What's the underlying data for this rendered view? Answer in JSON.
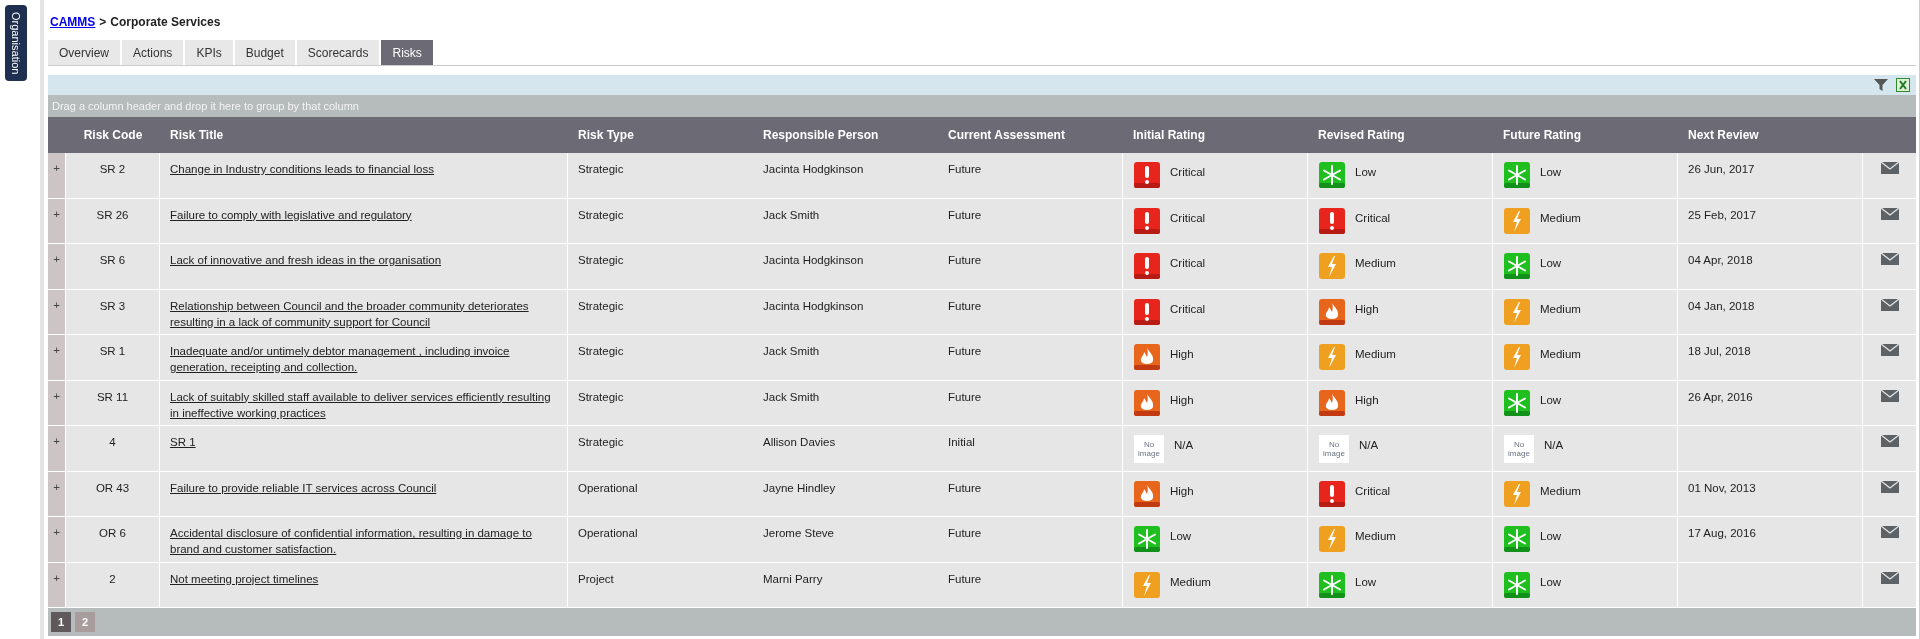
{
  "side_tab": "Organisation",
  "breadcrumb": {
    "link": "CAMMS",
    "separator": ">",
    "current": "Corporate Services"
  },
  "tabs": [
    {
      "label": "Overview",
      "selected": false
    },
    {
      "label": "Actions",
      "selected": false
    },
    {
      "label": "KPIs",
      "selected": false
    },
    {
      "label": "Budget",
      "selected": false
    },
    {
      "label": "Scorecards",
      "selected": false
    },
    {
      "label": "Risks",
      "selected": true
    }
  ],
  "group_hint": "Drag a column header and drop it here to group by that column",
  "table": {
    "columns": [
      "Risk Code",
      "Risk Title",
      "Risk Type",
      "Responsible Person",
      "Current Assessment",
      "Initial Rating",
      "Revised Rating",
      "Future Rating",
      "Next Review"
    ],
    "rows": [
      {
        "expander": "+",
        "code": "SR 2",
        "title": "Change in Industry conditions leads to financial loss",
        "type": "Strategic",
        "person": "Jacinta Hodgkinson",
        "assessment": "Future",
        "ratings": [
          {
            "kind": "critical",
            "label": "Critical"
          },
          {
            "kind": "low",
            "label": "Low"
          },
          {
            "kind": "low",
            "label": "Low"
          }
        ],
        "next_review": "26 Jun, 2017"
      },
      {
        "expander": "+",
        "code": "SR 26",
        "title": "Failure to comply with legislative and regulatory",
        "type": "Strategic",
        "person": "Jack Smith",
        "assessment": "Future",
        "ratings": [
          {
            "kind": "critical",
            "label": "Critical"
          },
          {
            "kind": "critical",
            "label": "Critical"
          },
          {
            "kind": "medium",
            "label": "Medium"
          }
        ],
        "next_review": "25 Feb, 2017"
      },
      {
        "expander": "+",
        "code": "SR 6",
        "title": "Lack of innovative and fresh ideas in the organisation",
        "type": "Strategic",
        "person": "Jacinta Hodgkinson",
        "assessment": "Future",
        "ratings": [
          {
            "kind": "critical",
            "label": "Critical"
          },
          {
            "kind": "medium",
            "label": "Medium"
          },
          {
            "kind": "low",
            "label": "Low"
          }
        ],
        "next_review": "04 Apr, 2018"
      },
      {
        "expander": "+",
        "code": "SR 3",
        "title": "Relationship between Council and the broader community deteriorates resulting in a lack of community support for Council",
        "type": "Strategic",
        "person": "Jacinta Hodgkinson",
        "assessment": "Future",
        "ratings": [
          {
            "kind": "critical",
            "label": "Critical"
          },
          {
            "kind": "high",
            "label": "High"
          },
          {
            "kind": "medium",
            "label": "Medium"
          }
        ],
        "next_review": "04 Jan, 2018"
      },
      {
        "expander": "+",
        "code": "SR 1",
        "title": "Inadequate and/or untimely debtor management , including invoice generation, receipting and collection.",
        "type": "Strategic",
        "person": "Jack Smith",
        "assessment": "Future",
        "ratings": [
          {
            "kind": "high",
            "label": "High"
          },
          {
            "kind": "medium",
            "label": "Medium"
          },
          {
            "kind": "medium",
            "label": "Medium"
          }
        ],
        "next_review": "18 Jul, 2018"
      },
      {
        "expander": "+",
        "code": "SR 11",
        "title": "Lack of suitably skilled staff available to deliver services efficiently resulting in ineffective working practices",
        "type": "Strategic",
        "person": "Jack Smith",
        "assessment": "Future",
        "ratings": [
          {
            "kind": "high",
            "label": "High"
          },
          {
            "kind": "high",
            "label": "High"
          },
          {
            "kind": "low",
            "label": "Low"
          }
        ],
        "next_review": "26 Apr, 2016"
      },
      {
        "expander": "+",
        "code": "4",
        "title": "SR 1",
        "type": "Strategic",
        "person": "Allison Davies",
        "assessment": "Initial",
        "ratings": [
          {
            "kind": "none",
            "label": "N/A",
            "icon_text": "No image"
          },
          {
            "kind": "none",
            "label": "N/A",
            "icon_text": "No image"
          },
          {
            "kind": "none",
            "label": "N/A",
            "icon_text": "No image"
          }
        ]
      },
      {
        "expander": "+",
        "code": "OR 43",
        "title": "Failure to provide reliable IT services across Council",
        "type": "Operational",
        "person": "Jayne Hindley",
        "assessment": "Future",
        "ratings": [
          {
            "kind": "high",
            "label": "High"
          },
          {
            "kind": "critical",
            "label": "Critical"
          },
          {
            "kind": "medium",
            "label": "Medium"
          }
        ],
        "next_review": "01 Nov, 2013"
      },
      {
        "expander": "+",
        "code": "OR 6",
        "title": "Accidental disclosure of confidential information, resulting in damage to brand and customer satisfaction.",
        "type": "Operational",
        "person": "Jerome Steve",
        "assessment": "Future",
        "ratings": [
          {
            "kind": "low",
            "label": "Low"
          },
          {
            "kind": "medium",
            "label": "Medium"
          },
          {
            "kind": "low",
            "label": "Low"
          }
        ],
        "next_review": "17 Aug, 2016"
      },
      {
        "expander": "+",
        "code": "2",
        "title": "Not meeting project timelines",
        "type": "Project",
        "person": "Marni Parry",
        "assessment": "Future",
        "ratings": [
          {
            "kind": "medium",
            "label": "Medium"
          },
          {
            "kind": "low",
            "label": "Low"
          },
          {
            "kind": "low",
            "label": "Low"
          }
        ]
      }
    ]
  },
  "pages": [
    {
      "label": "1",
      "selected": true
    },
    {
      "label": "2",
      "selected": false
    }
  ]
}
